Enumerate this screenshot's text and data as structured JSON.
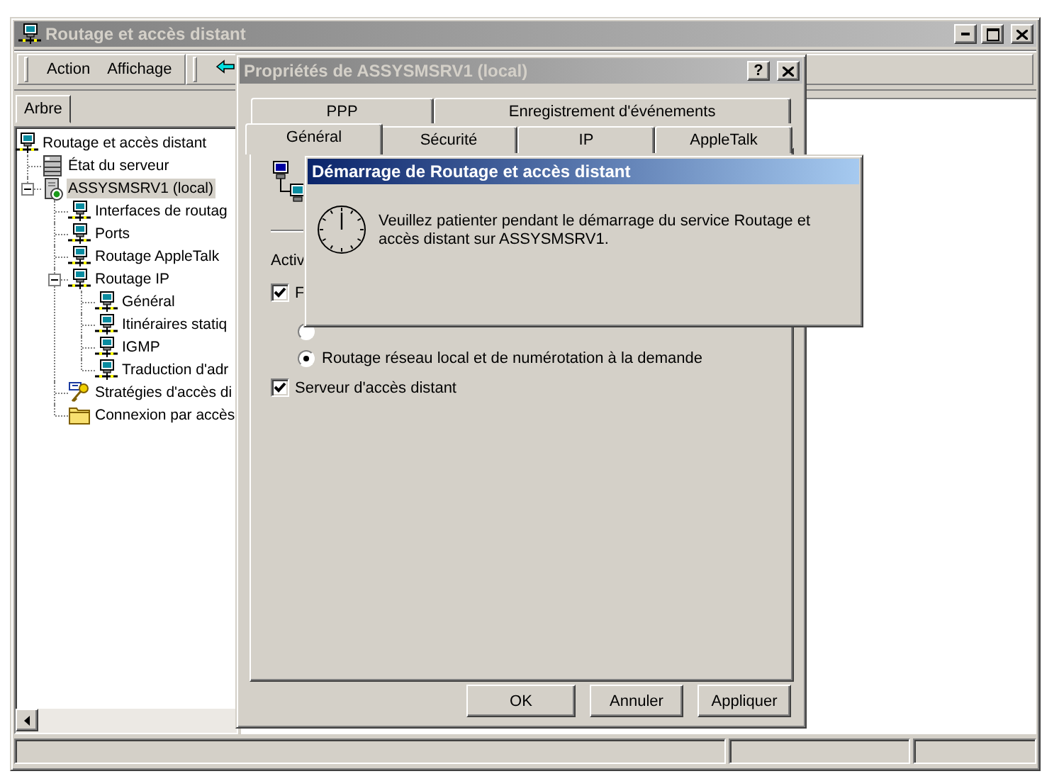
{
  "main_window": {
    "title": "Routage et accès distant",
    "active": false
  },
  "menu": [
    "Action",
    "Affichage"
  ],
  "tree_tab": {
    "label": "Arbre",
    "selected": true
  },
  "tree": [
    {
      "label": "Routage et accès distant",
      "kind": "network",
      "selected": false,
      "children": [
        {
          "label": "État du serveur",
          "kind": "server-status",
          "selected": false
        },
        {
          "label": "ASSYSMSRV1 (local)",
          "kind": "server",
          "selected": true,
          "expanded": true,
          "children": [
            {
              "label": "Interfaces de routag",
              "kind": "network",
              "selected": false
            },
            {
              "label": "Ports",
              "kind": "network",
              "selected": false
            },
            {
              "label": "Routage AppleTalk",
              "kind": "network",
              "selected": false
            },
            {
              "label": "Routage IP",
              "kind": "network",
              "selected": false,
              "expanded": true,
              "children": [
                {
                  "label": "Général",
                  "kind": "network",
                  "selected": false
                },
                {
                  "label": "Itinéraires statiq",
                  "kind": "network",
                  "selected": false
                },
                {
                  "label": "IGMP",
                  "kind": "network",
                  "selected": false
                },
                {
                  "label": "Traduction d'adr",
                  "kind": "network",
                  "selected": false
                }
              ]
            },
            {
              "label": "Stratégies d'accès di",
              "kind": "policy",
              "selected": false
            },
            {
              "label": "Connexion par accès",
              "kind": "folder",
              "selected": false
            }
          ]
        }
      ]
    }
  ],
  "properties_dialog": {
    "title": "Propriétés de ASSYSMSRV1 (local)",
    "active": false,
    "help_button": "?",
    "tab_rows": [
      [
        {
          "label": "PPP",
          "selected": false
        },
        {
          "label": "Enregistrement d'événements",
          "selected": false
        }
      ],
      [
        {
          "label": "Général",
          "selected": true
        },
        {
          "label": "Sécurité",
          "selected": false
        },
        {
          "label": "IP",
          "selected": false
        },
        {
          "label": "AppleTalk",
          "selected": false
        }
      ]
    ],
    "section_label": "Activ",
    "options": [
      {
        "kind": "checkbox",
        "label": "F",
        "checked": true
      },
      {
        "kind": "radio",
        "selected": false
      },
      {
        "kind": "radio",
        "label": "Routage réseau local et de numérotation à la demande",
        "selected": true
      },
      {
        "kind": "checkbox",
        "label": "Serveur d'accès distant",
        "checked": true
      }
    ],
    "buttons": [
      "OK",
      "Annuler",
      "Appliquer"
    ]
  },
  "startup_dialog": {
    "title": "Démarrage de Routage et accès distant",
    "active": true,
    "message": "Veuillez patienter pendant le démarrage du service Routage et accès distant sur ASSYSMSRV1."
  }
}
